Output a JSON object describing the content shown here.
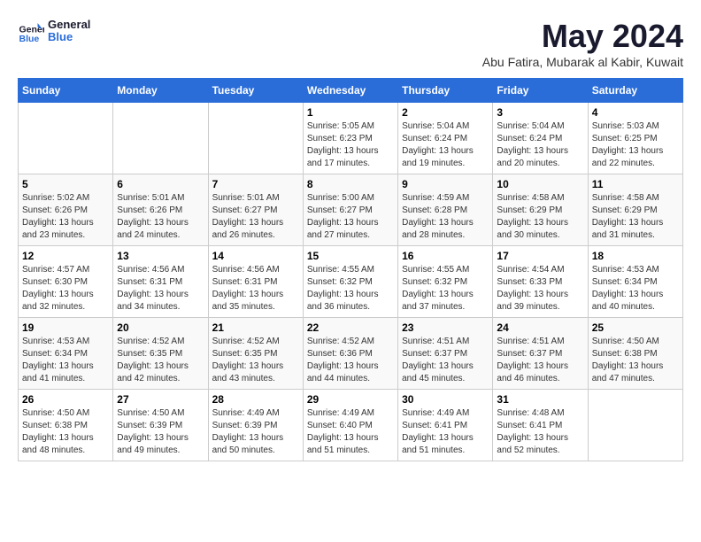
{
  "logo": {
    "text_general": "General",
    "text_blue": "Blue"
  },
  "title": "May 2024",
  "subtitle": "Abu Fatira, Mubarak al Kabir, Kuwait",
  "headers": [
    "Sunday",
    "Monday",
    "Tuesday",
    "Wednesday",
    "Thursday",
    "Friday",
    "Saturday"
  ],
  "weeks": [
    [
      {
        "day": "",
        "info": ""
      },
      {
        "day": "",
        "info": ""
      },
      {
        "day": "",
        "info": ""
      },
      {
        "day": "1",
        "info": "Sunrise: 5:05 AM\nSunset: 6:23 PM\nDaylight: 13 hours\nand 17 minutes."
      },
      {
        "day": "2",
        "info": "Sunrise: 5:04 AM\nSunset: 6:24 PM\nDaylight: 13 hours\nand 19 minutes."
      },
      {
        "day": "3",
        "info": "Sunrise: 5:04 AM\nSunset: 6:24 PM\nDaylight: 13 hours\nand 20 minutes."
      },
      {
        "day": "4",
        "info": "Sunrise: 5:03 AM\nSunset: 6:25 PM\nDaylight: 13 hours\nand 22 minutes."
      }
    ],
    [
      {
        "day": "5",
        "info": "Sunrise: 5:02 AM\nSunset: 6:26 PM\nDaylight: 13 hours\nand 23 minutes."
      },
      {
        "day": "6",
        "info": "Sunrise: 5:01 AM\nSunset: 6:26 PM\nDaylight: 13 hours\nand 24 minutes."
      },
      {
        "day": "7",
        "info": "Sunrise: 5:01 AM\nSunset: 6:27 PM\nDaylight: 13 hours\nand 26 minutes."
      },
      {
        "day": "8",
        "info": "Sunrise: 5:00 AM\nSunset: 6:27 PM\nDaylight: 13 hours\nand 27 minutes."
      },
      {
        "day": "9",
        "info": "Sunrise: 4:59 AM\nSunset: 6:28 PM\nDaylight: 13 hours\nand 28 minutes."
      },
      {
        "day": "10",
        "info": "Sunrise: 4:58 AM\nSunset: 6:29 PM\nDaylight: 13 hours\nand 30 minutes."
      },
      {
        "day": "11",
        "info": "Sunrise: 4:58 AM\nSunset: 6:29 PM\nDaylight: 13 hours\nand 31 minutes."
      }
    ],
    [
      {
        "day": "12",
        "info": "Sunrise: 4:57 AM\nSunset: 6:30 PM\nDaylight: 13 hours\nand 32 minutes."
      },
      {
        "day": "13",
        "info": "Sunrise: 4:56 AM\nSunset: 6:31 PM\nDaylight: 13 hours\nand 34 minutes."
      },
      {
        "day": "14",
        "info": "Sunrise: 4:56 AM\nSunset: 6:31 PM\nDaylight: 13 hours\nand 35 minutes."
      },
      {
        "day": "15",
        "info": "Sunrise: 4:55 AM\nSunset: 6:32 PM\nDaylight: 13 hours\nand 36 minutes."
      },
      {
        "day": "16",
        "info": "Sunrise: 4:55 AM\nSunset: 6:32 PM\nDaylight: 13 hours\nand 37 minutes."
      },
      {
        "day": "17",
        "info": "Sunrise: 4:54 AM\nSunset: 6:33 PM\nDaylight: 13 hours\nand 39 minutes."
      },
      {
        "day": "18",
        "info": "Sunrise: 4:53 AM\nSunset: 6:34 PM\nDaylight: 13 hours\nand 40 minutes."
      }
    ],
    [
      {
        "day": "19",
        "info": "Sunrise: 4:53 AM\nSunset: 6:34 PM\nDaylight: 13 hours\nand 41 minutes."
      },
      {
        "day": "20",
        "info": "Sunrise: 4:52 AM\nSunset: 6:35 PM\nDaylight: 13 hours\nand 42 minutes."
      },
      {
        "day": "21",
        "info": "Sunrise: 4:52 AM\nSunset: 6:35 PM\nDaylight: 13 hours\nand 43 minutes."
      },
      {
        "day": "22",
        "info": "Sunrise: 4:52 AM\nSunset: 6:36 PM\nDaylight: 13 hours\nand 44 minutes."
      },
      {
        "day": "23",
        "info": "Sunrise: 4:51 AM\nSunset: 6:37 PM\nDaylight: 13 hours\nand 45 minutes."
      },
      {
        "day": "24",
        "info": "Sunrise: 4:51 AM\nSunset: 6:37 PM\nDaylight: 13 hours\nand 46 minutes."
      },
      {
        "day": "25",
        "info": "Sunrise: 4:50 AM\nSunset: 6:38 PM\nDaylight: 13 hours\nand 47 minutes."
      }
    ],
    [
      {
        "day": "26",
        "info": "Sunrise: 4:50 AM\nSunset: 6:38 PM\nDaylight: 13 hours\nand 48 minutes."
      },
      {
        "day": "27",
        "info": "Sunrise: 4:50 AM\nSunset: 6:39 PM\nDaylight: 13 hours\nand 49 minutes."
      },
      {
        "day": "28",
        "info": "Sunrise: 4:49 AM\nSunset: 6:39 PM\nDaylight: 13 hours\nand 50 minutes."
      },
      {
        "day": "29",
        "info": "Sunrise: 4:49 AM\nSunset: 6:40 PM\nDaylight: 13 hours\nand 51 minutes."
      },
      {
        "day": "30",
        "info": "Sunrise: 4:49 AM\nSunset: 6:41 PM\nDaylight: 13 hours\nand 51 minutes."
      },
      {
        "day": "31",
        "info": "Sunrise: 4:48 AM\nSunset: 6:41 PM\nDaylight: 13 hours\nand 52 minutes."
      },
      {
        "day": "",
        "info": ""
      }
    ]
  ]
}
